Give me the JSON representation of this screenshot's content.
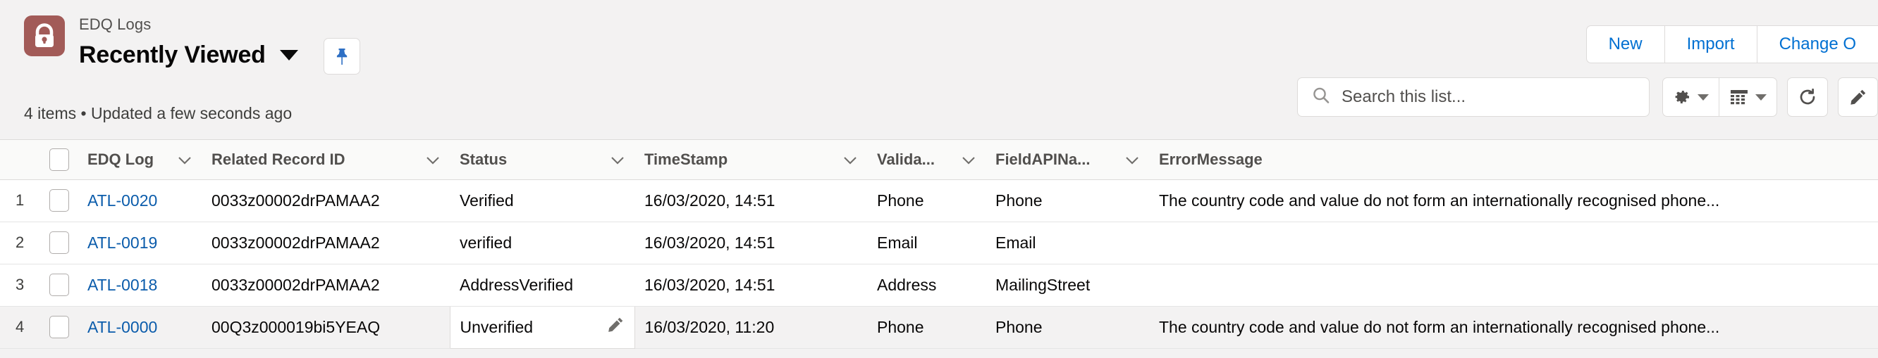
{
  "header": {
    "entity_name": "EDQ Logs",
    "list_view_title": "Recently Viewed",
    "object_icon": "padlock-icon",
    "icon_color": "#a25b58",
    "view_caret_icon": "chevron-down-icon",
    "pin_icon": "pin-icon",
    "pin_color": "#2e6fc4",
    "meta_text": "4 items • Updated a few seconds ago",
    "actions": [
      {
        "label": "New",
        "name": "new-button"
      },
      {
        "label": "Import",
        "name": "import-button"
      },
      {
        "label": "Change O",
        "name": "change-owner-button"
      }
    ]
  },
  "toolbar": {
    "search": {
      "placeholder": "Search this list...",
      "value": "",
      "icon": "search-icon"
    },
    "buttons": [
      {
        "name": "list-view-controls-button",
        "icon": "gear-icon",
        "has_caret": true
      },
      {
        "name": "display-as-button",
        "icon": "table-icon",
        "has_caret": true
      },
      {
        "name": "refresh-button",
        "icon": "refresh-icon",
        "has_caret": false
      },
      {
        "name": "edit-list-button",
        "icon": "pencil-icon",
        "has_caret": false
      }
    ]
  },
  "table": {
    "select_all_checkbox": "select-all-checkbox",
    "columns": [
      {
        "label": "EDQ Log",
        "sortable": true
      },
      {
        "label": "Related Record ID",
        "sortable": true
      },
      {
        "label": "Status",
        "sortable": true
      },
      {
        "label": "TimeStamp",
        "sortable": true
      },
      {
        "label": "Valida...",
        "sortable": true
      },
      {
        "label": "FieldAPINa...",
        "sortable": true
      },
      {
        "label": "ErrorMessage",
        "sortable": false
      }
    ],
    "rows": [
      {
        "num": "1",
        "edq_log": "ATL-0020",
        "related_record_id": "0033z00002drPAMAA2",
        "status": "Verified",
        "timestamp": "16/03/2020, 14:51",
        "validation": "Phone",
        "field_api_name": "Phone",
        "error_message": "The country code and value do not form an internationally recognised phone...",
        "hovered": false,
        "editing_status": false
      },
      {
        "num": "2",
        "edq_log": "ATL-0019",
        "related_record_id": "0033z00002drPAMAA2",
        "status": "verified",
        "timestamp": "16/03/2020, 14:51",
        "validation": "Email",
        "field_api_name": "Email",
        "error_message": "",
        "hovered": false,
        "editing_status": false
      },
      {
        "num": "3",
        "edq_log": "ATL-0018",
        "related_record_id": "0033z00002drPAMAA2",
        "status": "AddressVerified",
        "timestamp": "16/03/2020, 14:51",
        "validation": "Address",
        "field_api_name": "MailingStreet",
        "error_message": "",
        "hovered": false,
        "editing_status": false
      },
      {
        "num": "4",
        "edq_log": "ATL-0000",
        "related_record_id": "00Q3z000019bi5YEAQ",
        "status": "Unverified",
        "timestamp": "16/03/2020, 11:20",
        "validation": "Phone",
        "field_api_name": "Phone",
        "error_message": "The country code and value do not form an internationally recognised phone...",
        "hovered": true,
        "editing_status": true
      }
    ]
  }
}
